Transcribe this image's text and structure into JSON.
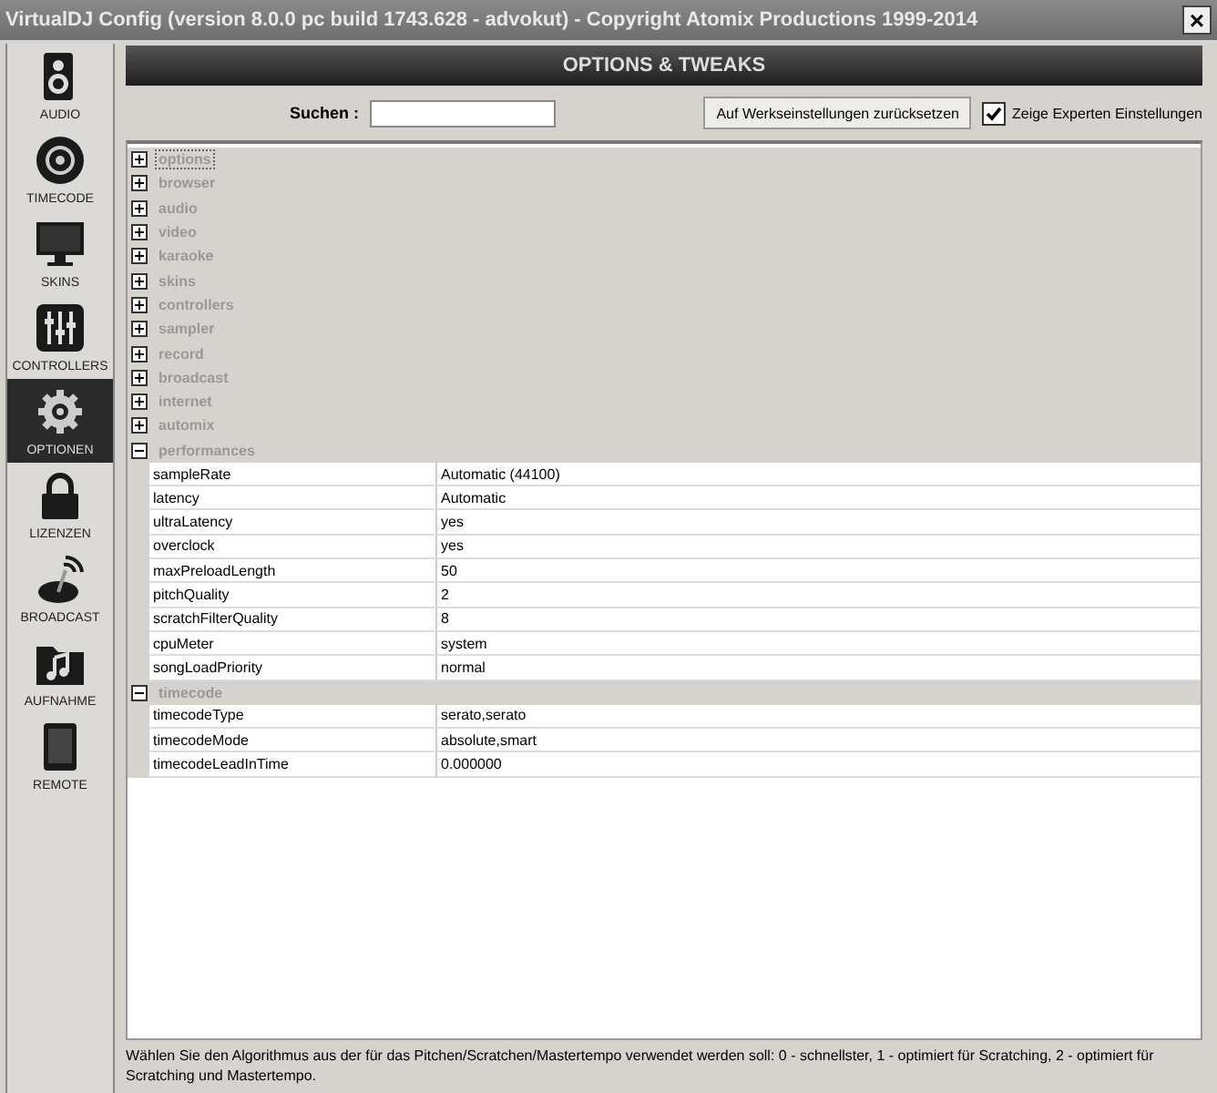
{
  "window": {
    "title": "VirtualDJ Config (version 8.0.0 pc build 1743.628 - advokut) - Copyright Atomix Productions 1999-2014",
    "close": "×"
  },
  "sidebar": {
    "items": [
      {
        "label": "AUDIO",
        "kind": "speaker",
        "selected": false
      },
      {
        "label": "TIMECODE",
        "kind": "disc",
        "selected": false
      },
      {
        "label": "SKINS",
        "kind": "monitor",
        "selected": false
      },
      {
        "label": "CONTROLLERS",
        "kind": "sliders",
        "selected": false
      },
      {
        "label": "OPTIONEN",
        "kind": "gear",
        "selected": true
      },
      {
        "label": "LIZENZEN",
        "kind": "lock",
        "selected": false
      },
      {
        "label": "BROADCAST",
        "kind": "antenna",
        "selected": false
      },
      {
        "label": "AUFNAHME",
        "kind": "folder",
        "selected": false
      },
      {
        "label": "REMOTE",
        "kind": "tablet",
        "selected": false
      }
    ]
  },
  "header": {
    "title": "OPTIONS & TWEAKS"
  },
  "search": {
    "label": "Suchen :"
  },
  "reset_button": "Auf Werkseinstellungen zurücksetzen",
  "expert_checkbox": {
    "label": "Zeige Experten Einstellungen",
    "checked": true
  },
  "tree": [
    {
      "label": "options",
      "expanded": false,
      "selected": true
    },
    {
      "label": "browser",
      "expanded": false,
      "selected": false
    },
    {
      "label": "audio",
      "expanded": false,
      "selected": false
    },
    {
      "label": "video",
      "expanded": false,
      "selected": false
    },
    {
      "label": "karaoke",
      "expanded": false,
      "selected": false
    },
    {
      "label": "skins",
      "expanded": false,
      "selected": false
    },
    {
      "label": "controllers",
      "expanded": false,
      "selected": false
    },
    {
      "label": "sampler",
      "expanded": false,
      "selected": false
    },
    {
      "label": "record",
      "expanded": false,
      "selected": false
    },
    {
      "label": "broadcast",
      "expanded": false,
      "selected": false
    },
    {
      "label": "internet",
      "expanded": false,
      "selected": false
    },
    {
      "label": "automix",
      "expanded": false,
      "selected": false
    },
    {
      "label": "performances",
      "expanded": true,
      "selected": false,
      "children": [
        {
          "name": "sampleRate",
          "value": "Automatic (44100)"
        },
        {
          "name": "latency",
          "value": "Automatic"
        },
        {
          "name": "ultraLatency",
          "value": "yes"
        },
        {
          "name": "overclock",
          "value": "yes"
        },
        {
          "name": "maxPreloadLength",
          "value": "50"
        },
        {
          "name": "pitchQuality",
          "value": "2"
        },
        {
          "name": "scratchFilterQuality",
          "value": "8"
        },
        {
          "name": "cpuMeter",
          "value": "system"
        },
        {
          "name": "songLoadPriority",
          "value": "normal"
        }
      ]
    },
    {
      "label": "timecode",
      "expanded": true,
      "selected": false,
      "children": [
        {
          "name": "timecodeType",
          "value": "serato,serato"
        },
        {
          "name": "timecodeMode",
          "value": "absolute,smart"
        },
        {
          "name": "timecodeLeadInTime",
          "value": "0.000000"
        }
      ]
    }
  ],
  "help_text": "Wählen Sie den Algorithmus aus der für das Pitchen/Scratchen/Mastertempo verwendet werden soll: 0 - schnellster, 1 - optimiert für Scratching, 2 - optimiert für Scratching und Mastertempo."
}
